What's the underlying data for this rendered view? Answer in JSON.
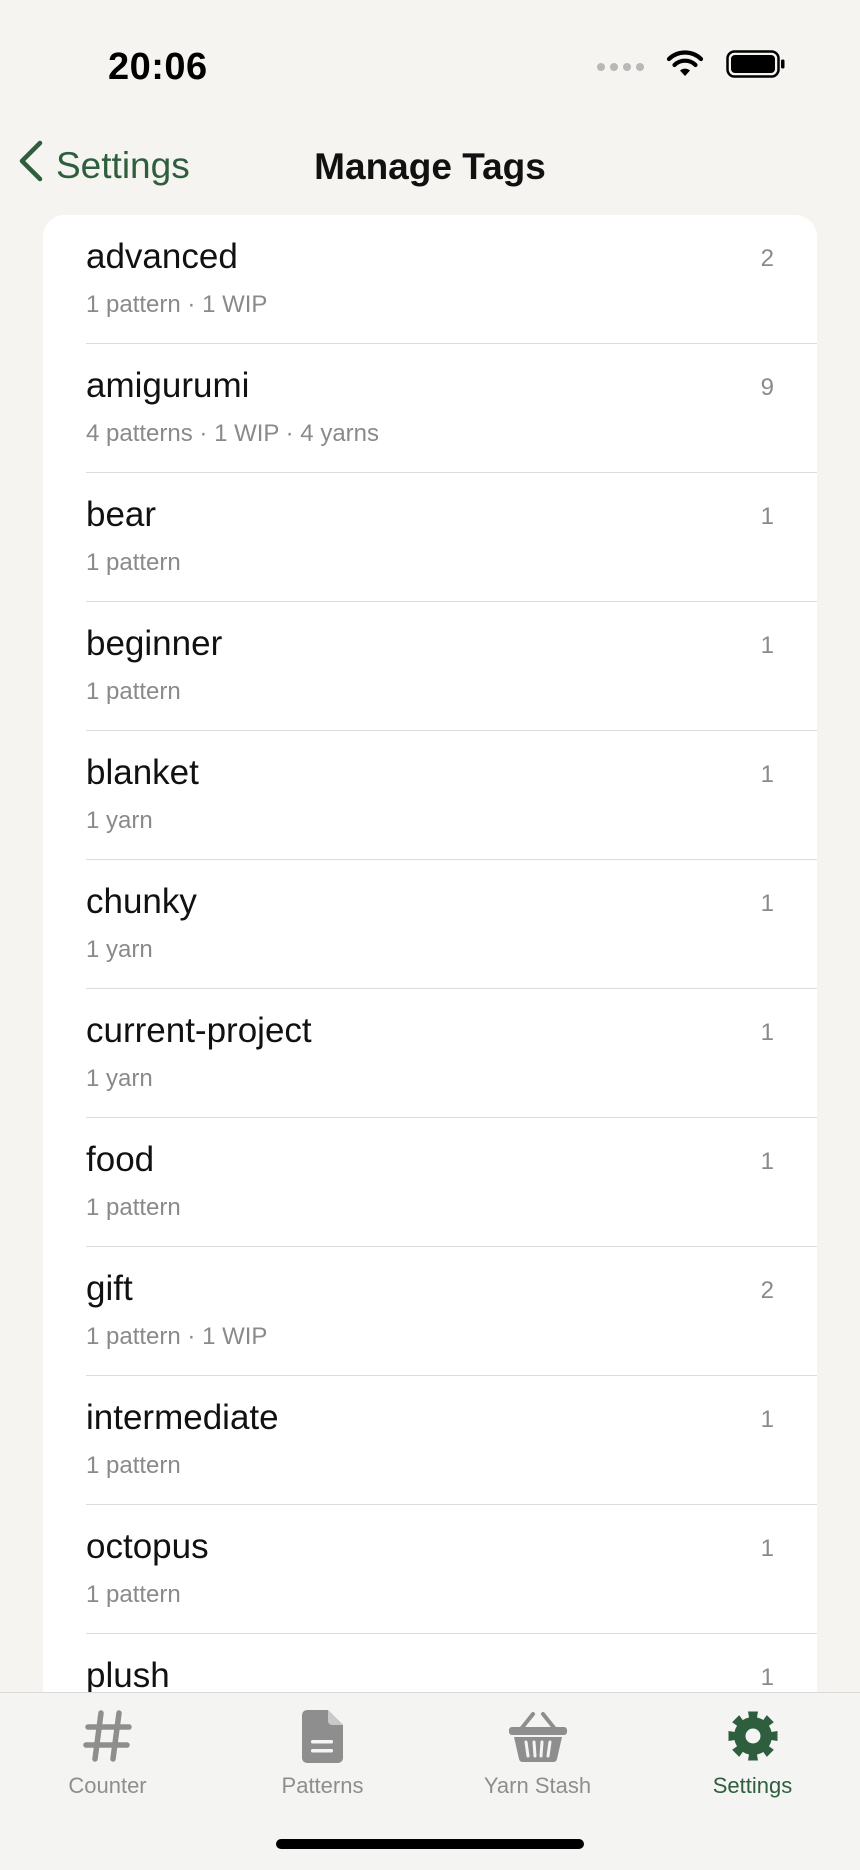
{
  "status": {
    "time": "20:06"
  },
  "nav": {
    "back_label": "Settings",
    "title": "Manage Tags"
  },
  "tags": [
    {
      "name": "advanced",
      "subtitle": "1 pattern · 1 WIP",
      "count": "2"
    },
    {
      "name": "amigurumi",
      "subtitle": "4 patterns · 1 WIP · 4 yarns",
      "count": "9"
    },
    {
      "name": "bear",
      "subtitle": "1 pattern",
      "count": "1"
    },
    {
      "name": "beginner",
      "subtitle": "1 pattern",
      "count": "1"
    },
    {
      "name": "blanket",
      "subtitle": "1 yarn",
      "count": "1"
    },
    {
      "name": "chunky",
      "subtitle": "1 yarn",
      "count": "1"
    },
    {
      "name": "current-project",
      "subtitle": "1 yarn",
      "count": "1"
    },
    {
      "name": "food",
      "subtitle": "1 pattern",
      "count": "1"
    },
    {
      "name": "gift",
      "subtitle": "1 pattern · 1 WIP",
      "count": "2"
    },
    {
      "name": "intermediate",
      "subtitle": "1 pattern",
      "count": "1"
    },
    {
      "name": "octopus",
      "subtitle": "1 pattern",
      "count": "1"
    },
    {
      "name": "plush",
      "subtitle": "",
      "count": "1"
    }
  ],
  "tabbar": {
    "tabs": [
      {
        "label": "Counter",
        "icon": "hash-icon",
        "active": false
      },
      {
        "label": "Patterns",
        "icon": "document-icon",
        "active": false
      },
      {
        "label": "Yarn Stash",
        "icon": "basket-icon",
        "active": false
      },
      {
        "label": "Settings",
        "icon": "gear-icon",
        "active": true
      }
    ]
  },
  "colors": {
    "accent": "#2e5e3d",
    "inactive": "#8e8e8e",
    "background": "#f5f4f0"
  }
}
